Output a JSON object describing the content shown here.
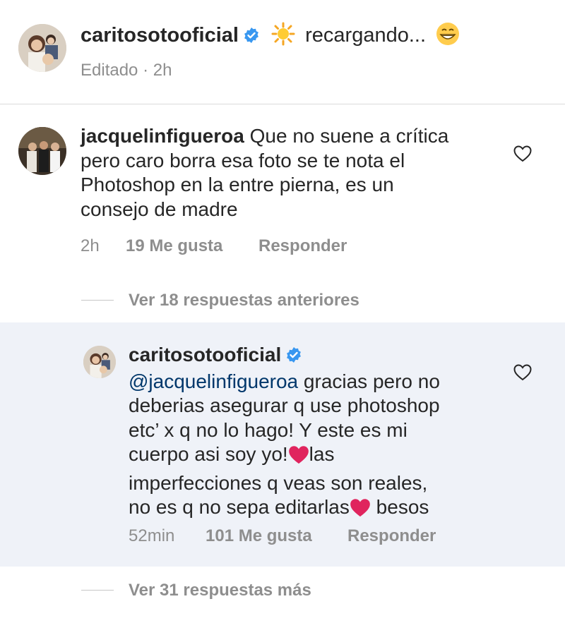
{
  "caption": {
    "username": "caritosotooficial",
    "text_after_sun": "recargando...",
    "sun_emoji": "☀",
    "grin_emoji": "😁",
    "meta": "Editado · 2h"
  },
  "comment1": {
    "username": "jacquelinfigueroa",
    "text": "Que no suene a crítica pero caro borra esa foto se te nota el Photoshop en la entre pierna, es un consejo de madre",
    "lines": [
      "Que no suene a crítica",
      "pero caro borra esa foto se te nota el",
      "Photoshop en la entre pierna, es un",
      "consejo de madre"
    ],
    "time": "2h",
    "likes": "19 Me gusta",
    "reply_label": "Responder",
    "heart_icon": "heart-outline-icon"
  },
  "view_previous": "Ver 18 respuestas anteriores",
  "reply": {
    "username": "caritosotooficial",
    "mention": "@jacquelinfigueroa",
    "lines": [
      " gracias pero no",
      "deberias asegurar q use photoshop",
      "etc’ x q no lo hago! Y este es mi",
      "cuerpo asi soy yo!",
      "las",
      "imperfecciones q veas son reales,",
      "no es q no sepa editarlas",
      " besos"
    ],
    "heart_emoji": "❤️",
    "time": "52min",
    "likes": "101 Me gusta",
    "reply_label": "Responder"
  },
  "view_more": "Ver 31 respuestas más",
  "colors": {
    "verified_blue": "#3897f0",
    "mention_blue": "#00376b",
    "meta_gray": "#8e8e8e",
    "reply_highlight": "#eff2f8",
    "heart_red": "#e0245e"
  }
}
